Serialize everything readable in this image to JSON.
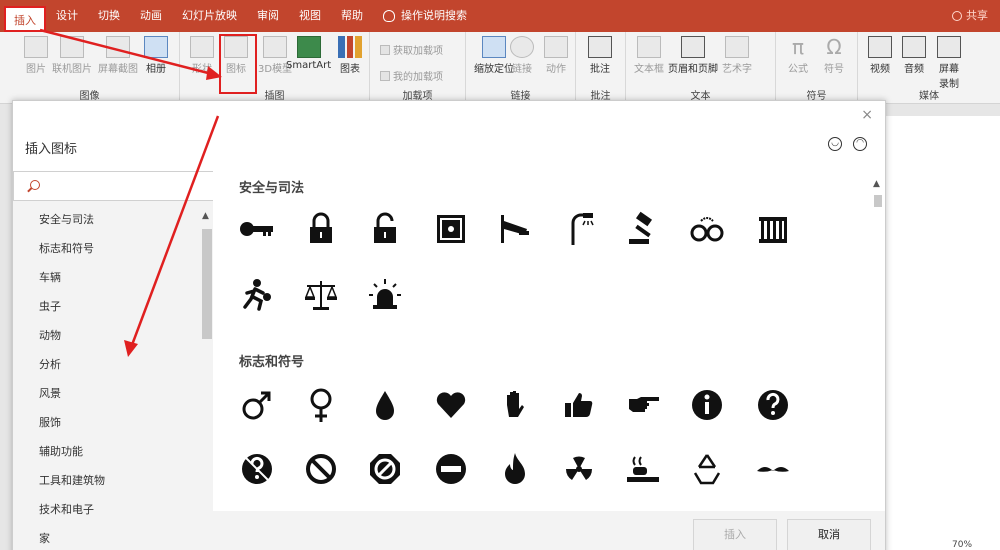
{
  "tabs": [
    "插入",
    "设计",
    "切换",
    "动画",
    "幻灯片放映",
    "审阅",
    "视图",
    "帮助"
  ],
  "tell_me": "操作说明搜索",
  "share": "共享",
  "ribbon": {
    "images": {
      "label": "图像",
      "btns": [
        "图片",
        "联机图片",
        "屏幕截图",
        "相册"
      ]
    },
    "illus": {
      "label": "插图",
      "btns": [
        "形状",
        "图标",
        "3D模型",
        "SmartArt",
        "图表"
      ]
    },
    "addins": {
      "label": "加载项",
      "get": "获取加载项",
      "my": "我的加载项"
    },
    "links": {
      "label": "链接",
      "btns": [
        "缩放定位",
        "链接",
        "动作"
      ]
    },
    "comments": {
      "label": "批注",
      "btns": [
        "批注"
      ]
    },
    "text": {
      "label": "文本",
      "btns": [
        "文本框",
        "页眉和页脚",
        "艺术字"
      ]
    },
    "symbols": {
      "label": "符号",
      "btns": [
        "公式",
        "符号"
      ]
    },
    "media": {
      "label": "媒体",
      "btns": [
        "视频",
        "音频",
        "屏幕录制"
      ]
    }
  },
  "dialog": {
    "title": "插入图标",
    "close": "×",
    "categories": [
      "安全与司法",
      "标志和符号",
      "车辆",
      "虫子",
      "动物",
      "分析",
      "风景",
      "服饰",
      "辅助功能",
      "工具和建筑物",
      "技术和电子",
      "家"
    ],
    "sections": [
      "安全与司法",
      "标志和符号"
    ],
    "insert": "插入",
    "cancel": "取消"
  },
  "icons_row1": [
    "key-icon",
    "lock-icon",
    "unlock-icon",
    "safe-icon",
    "security-camera-icon",
    "street-light-icon",
    "gavel-icon",
    "handcuffs-icon",
    "jail-icon"
  ],
  "icons_row2": [
    "running-thief-icon",
    "scales-icon",
    "siren-icon"
  ],
  "icons_row3": [
    "male-icon",
    "female-icon",
    "drop-icon",
    "heart-icon",
    "hand-stop-icon",
    "thumbs-up-icon",
    "pointing-hand-icon",
    "info-icon",
    "question-icon"
  ],
  "icons_row4": [
    "no-question-icon",
    "prohibited-icon",
    "no-entry-slash-icon",
    "no-entry-icon",
    "fire-icon",
    "radiation-icon",
    "smoking-icon",
    "recycle-icon",
    "mustache-icon"
  ],
  "zoom": "70%"
}
